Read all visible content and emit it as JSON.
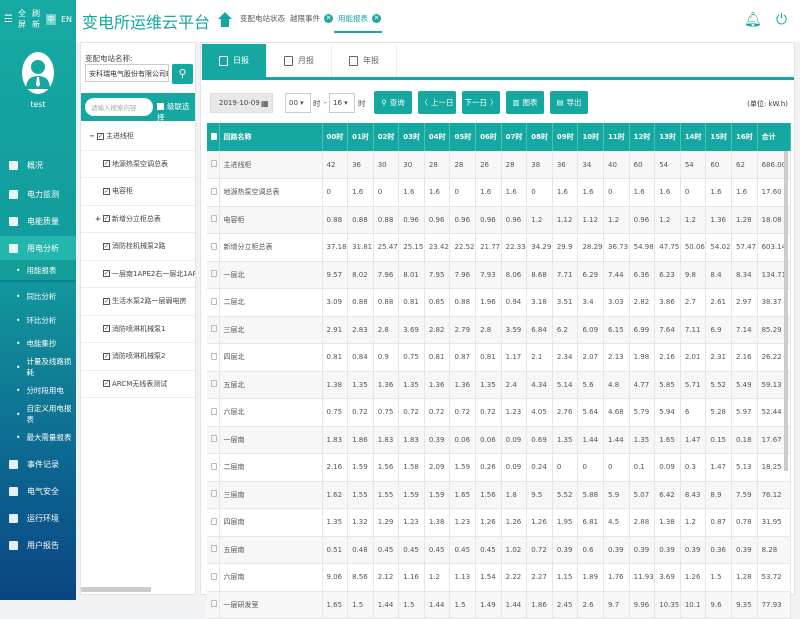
{
  "topbar": {
    "menu_icon": "hamburger-icon",
    "fullscreen": "全屏",
    "refresh": "刷新",
    "lang_zh": "中",
    "lang_en": "EN"
  },
  "user": {
    "name": "test"
  },
  "sidebar": {
    "items": [
      {
        "label": "概况",
        "icon": "monitor-icon"
      },
      {
        "label": "电力监测",
        "icon": "lightning-icon"
      },
      {
        "label": "电能质量",
        "icon": "document-icon"
      },
      {
        "label": "用电分析",
        "icon": "bar-chart-icon",
        "active": true
      },
      {
        "label": "事件记录",
        "icon": "clipboard-icon"
      },
      {
        "label": "电气安全",
        "icon": "alarm-icon"
      },
      {
        "label": "运行环境",
        "icon": "camera-icon"
      },
      {
        "label": "用户报告",
        "icon": "user-icon"
      }
    ],
    "subitems": [
      "用能报表",
      "同比分析",
      "环比分析",
      "电能集抄",
      "计量及线路损耗",
      "分时段用电",
      "自定义用电报表",
      "最大需量报表"
    ]
  },
  "header": {
    "title": "变电所运维云平台",
    "tabs": [
      {
        "label": "变配电站状态"
      },
      {
        "label": "越限事件",
        "closable": true
      },
      {
        "label": "用能报表",
        "closable": true,
        "active": true
      }
    ]
  },
  "tree": {
    "station_label": "变配电站名称:",
    "station_value": "安科瑞电气股份有限公司E...",
    "search_placeholder": "请输入搜索内容",
    "cascade_select": "级联选择",
    "items": [
      {
        "label": "主进线柜",
        "prefix": "−"
      },
      {
        "label": "地源热泵空调总表"
      },
      {
        "label": "电容柜"
      },
      {
        "label": "新增分立柜总表",
        "prefix": "+"
      },
      {
        "label": "消防栓机械泵2路"
      },
      {
        "label": "一层南1APE2右一层北1APE1左"
      },
      {
        "label": "生活水泵2路一层弱电房"
      },
      {
        "label": "消防喷淋机械泵1"
      },
      {
        "label": "消防喷淋机械泵2"
      },
      {
        "label": "ARCM无线表测试"
      }
    ]
  },
  "report": {
    "tabs": [
      "日报",
      "月报",
      "年报"
    ],
    "date": "2019-10-09",
    "hour_from": "00",
    "hour_to": "16",
    "hour_unit": "时",
    "dash": "-",
    "buttons": {
      "query": "查询",
      "prev": "上一日",
      "next": "下一日",
      "chart": "图表",
      "export": "导出"
    },
    "unit": "(单位: kW.h)"
  },
  "table": {
    "headers": [
      "回路名称",
      "00时",
      "01时",
      "02时",
      "03时",
      "04时",
      "05时",
      "06时",
      "07时",
      "08时",
      "09时",
      "10时",
      "11时",
      "12时",
      "13时",
      "14时",
      "15时",
      "16时",
      "合计"
    ],
    "rows": [
      [
        "主进线柜",
        "42",
        "36",
        "30",
        "30",
        "28",
        "28",
        "26",
        "28",
        "38",
        "36",
        "34",
        "40",
        "60",
        "54",
        "54",
        "60",
        "62",
        "686.00"
      ],
      [
        "地源热泵空调总表",
        "0",
        "1.6",
        "0",
        "1.6",
        "1.6",
        "0",
        "1.6",
        "1.6",
        "0",
        "1.6",
        "1.6",
        "0",
        "1.6",
        "1.6",
        "0",
        "1.6",
        "1.6",
        "17.60"
      ],
      [
        "电容柜",
        "0.88",
        "0.88",
        "0.88",
        "0.96",
        "0.96",
        "0.96",
        "0.96",
        "0.96",
        "1.2",
        "1.12",
        "1.12",
        "1.2",
        "0.96",
        "1.2",
        "1.2",
        "1.36",
        "1.28",
        "18.08"
      ],
      [
        "新增分立柜总表",
        "37.18",
        "31.81",
        "25.47",
        "25.15",
        "23.42",
        "22.52",
        "21.77",
        "22.33",
        "34.29",
        "29.9",
        "28.29",
        "36.73",
        "54.98",
        "47.75",
        "50.06",
        "54.02",
        "57.47",
        "603.14"
      ],
      [
        "一层北",
        "9.57",
        "8.02",
        "7.96",
        "8.01",
        "7.95",
        "7.96",
        "7.93",
        "8.06",
        "8.68",
        "7.71",
        "6.29",
        "7.44",
        "6.36",
        "6.23",
        "9.8",
        "8.4",
        "8.34",
        "134.71"
      ],
      [
        "二层北",
        "3.09",
        "0.88",
        "0.88",
        "0.81",
        "0.85",
        "0.88",
        "1.96",
        "0.94",
        "3.18",
        "3.51",
        "3.4",
        "3.03",
        "2.82",
        "3.86",
        "2.7",
        "2.61",
        "2.97",
        "38.37"
      ],
      [
        "三层北",
        "2.91",
        "2.83",
        "2.8",
        "3.69",
        "2.82",
        "2.79",
        "2.8",
        "3.59",
        "6.84",
        "6.2",
        "6.09",
        "6.15",
        "6.99",
        "7.64",
        "7.11",
        "6.9",
        "7.14",
        "85.29"
      ],
      [
        "四层北",
        "0.81",
        "0.84",
        "0.9",
        "0.75",
        "0.81",
        "0.87",
        "0.81",
        "1.17",
        "2.1",
        "2.34",
        "2.07",
        "2.13",
        "1.98",
        "2.16",
        "2.01",
        "2.31",
        "2.16",
        "26.22"
      ],
      [
        "五层北",
        "1.38",
        "1.35",
        "1.36",
        "1.35",
        "1.36",
        "1.36",
        "1.35",
        "2.4",
        "4.34",
        "5.14",
        "5.6",
        "4.8",
        "4.77",
        "5.85",
        "5.71",
        "5.52",
        "5.49",
        "59.13"
      ],
      [
        "六层北",
        "0.75",
        "0.72",
        "0.75",
        "0.72",
        "0.72",
        "0.72",
        "0.72",
        "1.23",
        "4.05",
        "2.76",
        "5.64",
        "4.68",
        "5.79",
        "5.94",
        "6",
        "5.28",
        "5.97",
        "52.44"
      ],
      [
        "一层南",
        "1.83",
        "1.86",
        "1.83",
        "1.83",
        "0.39",
        "0.06",
        "0.06",
        "0.09",
        "0.69",
        "1.35",
        "1.44",
        "1.44",
        "1.35",
        "1.65",
        "1.47",
        "0.15",
        "0.18",
        "17.67"
      ],
      [
        "二层南",
        "2.16",
        "1.59",
        "1.56",
        "1.58",
        "2.09",
        "1.59",
        "0.26",
        "0.09",
        "0.24",
        "0",
        "0",
        "0",
        "0.1",
        "0.09",
        "0.3",
        "1.47",
        "5.13",
        "18.25"
      ],
      [
        "三层南",
        "1.62",
        "1.55",
        "1.55",
        "1.59",
        "1.59",
        "1.65",
        "1.56",
        "1.8",
        "9.5",
        "5.52",
        "5.88",
        "5.9",
        "5.07",
        "6.42",
        "8.43",
        "8.9",
        "7.59",
        "76.12"
      ],
      [
        "四层南",
        "1.35",
        "1.32",
        "1.29",
        "1.23",
        "1.38",
        "1.23",
        "1.26",
        "1.26",
        "1.26",
        "1.95",
        "6.81",
        "4.5",
        "2.88",
        "1.38",
        "1.2",
        "0.87",
        "0.78",
        "31.95"
      ],
      [
        "五层南",
        "0.51",
        "0.48",
        "0.45",
        "0.45",
        "0.45",
        "0.45",
        "0.45",
        "1.02",
        "0.72",
        "0.39",
        "0.6",
        "0.39",
        "0.39",
        "0.39",
        "0.39",
        "0.36",
        "0.39",
        "8.28"
      ],
      [
        "六层南",
        "9.06",
        "8.56",
        "2.12",
        "1.16",
        "1.2",
        "1.13",
        "1.54",
        "2.22",
        "2.27",
        "1.15",
        "1.89",
        "1.76",
        "11.93",
        "3.69",
        "1.26",
        "1.5",
        "1.28",
        "53.72"
      ],
      [
        "一层研发室",
        "1.65",
        "1.5",
        "1.44",
        "1.5",
        "1.44",
        "1.5",
        "1.49",
        "1.44",
        "1.86",
        "2.45",
        "2.6",
        "9.7",
        "9.96",
        "10.35",
        "10.1",
        "9.6",
        "9.35",
        "77.93"
      ]
    ]
  },
  "colors": {
    "accent": "#14a8a0",
    "sidebar_bottom": "#0a4583"
  }
}
